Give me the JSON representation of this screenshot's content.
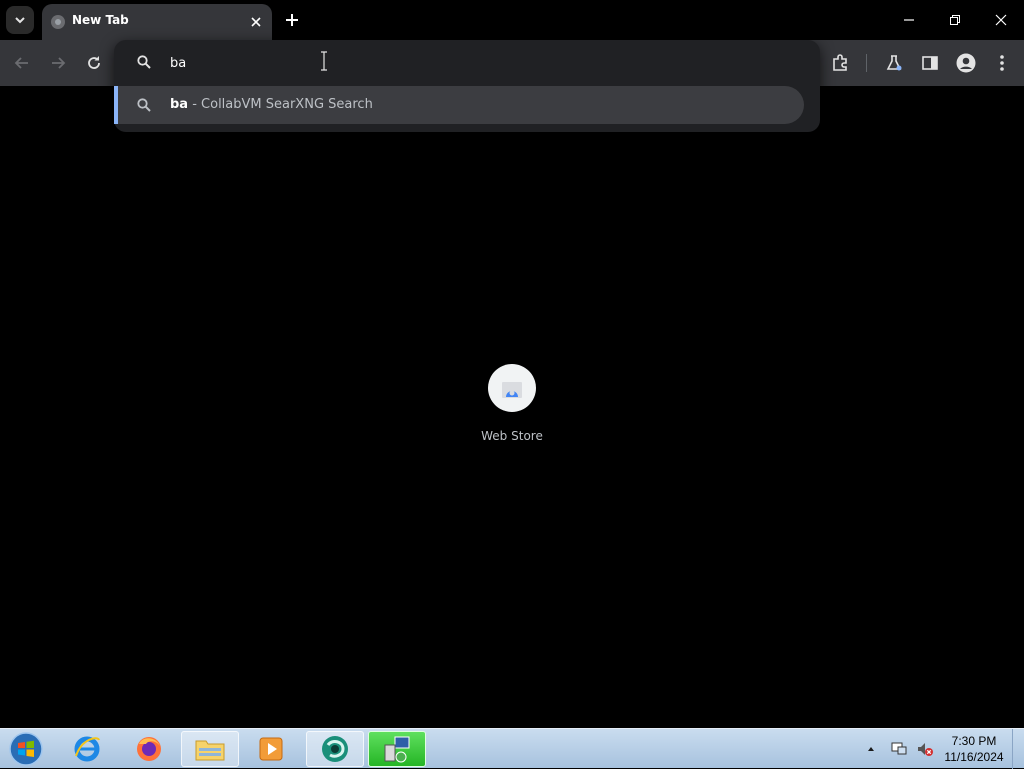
{
  "tab": {
    "title": "New Tab"
  },
  "omnibox": {
    "query": "ba"
  },
  "suggestion": {
    "query": "ba",
    "suffix": " - CollabVM SearXNG Search"
  },
  "shortcuts": [
    {
      "label": "Web Store"
    }
  ],
  "clock": {
    "time": "7:30 PM",
    "date": "11/16/2024"
  },
  "taskbar": {
    "apps": [
      "internet-explorer",
      "firefox",
      "file-explorer",
      "media-player",
      "browser-app",
      "network-app"
    ]
  },
  "colors": {
    "accent": "#8ab4f8",
    "toolbar": "#35363a",
    "popup": "#202124"
  }
}
